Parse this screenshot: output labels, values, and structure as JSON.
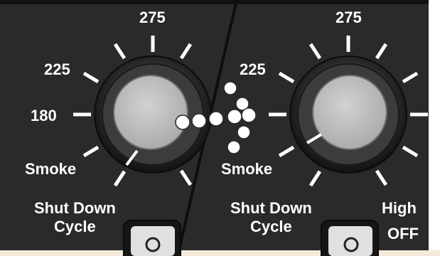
{
  "left_dial": {
    "labels": {
      "t275": "275",
      "t225": "225",
      "t180": "180",
      "smoke": "Smoke",
      "shutdown_line1": "Shut Down",
      "shutdown_line2": "Cycle"
    },
    "icons": [
      "dial-knob-icon",
      "tick-marks-icon",
      "power-switch-icon"
    ]
  },
  "right_dial": {
    "labels": {
      "t275": "275",
      "t225": "225",
      "smoke": "Smoke",
      "shutdown_line1": "Shut Down",
      "shutdown_line2": "Cycle",
      "high": "High",
      "off": "OFF"
    },
    "icons": [
      "dial-knob-icon",
      "tick-marks-icon",
      "power-switch-icon"
    ]
  },
  "colors": {
    "panel": "#2a2a2c",
    "panel_dark": "#1c1c1e",
    "knob_face": "#bdbdbd",
    "knob_ring": "#3a3a3c",
    "text": "#ffffff",
    "dots": "#ffffff"
  },
  "transition_icon": "dot-trail-icon"
}
